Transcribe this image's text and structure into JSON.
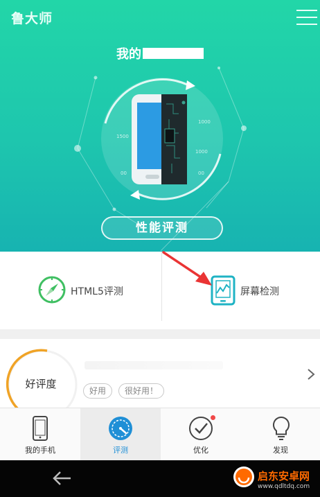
{
  "header": {
    "brand": "鲁大师",
    "menu_icon": "hamburger-menu-icon"
  },
  "hero": {
    "device_title": "我的",
    "gauge_ticks": [
      "1500",
      "1000",
      "00",
      "1000",
      "00"
    ],
    "evaluate_button": "性能评测"
  },
  "tools": {
    "html5": {
      "label": "HTML5评测",
      "icon": "compass-icon"
    },
    "screen": {
      "label": "屏幕检测",
      "icon": "screen-test-icon"
    }
  },
  "rating": {
    "label": "好评度",
    "chips": [
      "好用",
      "很好用！"
    ]
  },
  "nav": {
    "items": [
      {
        "label": "我的手机",
        "icon": "phone-icon"
      },
      {
        "label": "评测",
        "icon": "speedometer-icon",
        "active": true
      },
      {
        "label": "优化",
        "icon": "check-circle-icon",
        "badge": true
      },
      {
        "label": "发现",
        "icon": "lightbulb-icon"
      }
    ]
  },
  "watermark": {
    "name": "启东安卓网",
    "url": "www.qdltdq.com"
  },
  "colors": {
    "hero_top": "#22d6a8",
    "hero_bottom": "#17b3b1",
    "accent": "#1fb3c4",
    "nav_active": "#1f8fd6",
    "ring_orange": "#f0a326",
    "arrow_red": "#ea3434"
  }
}
